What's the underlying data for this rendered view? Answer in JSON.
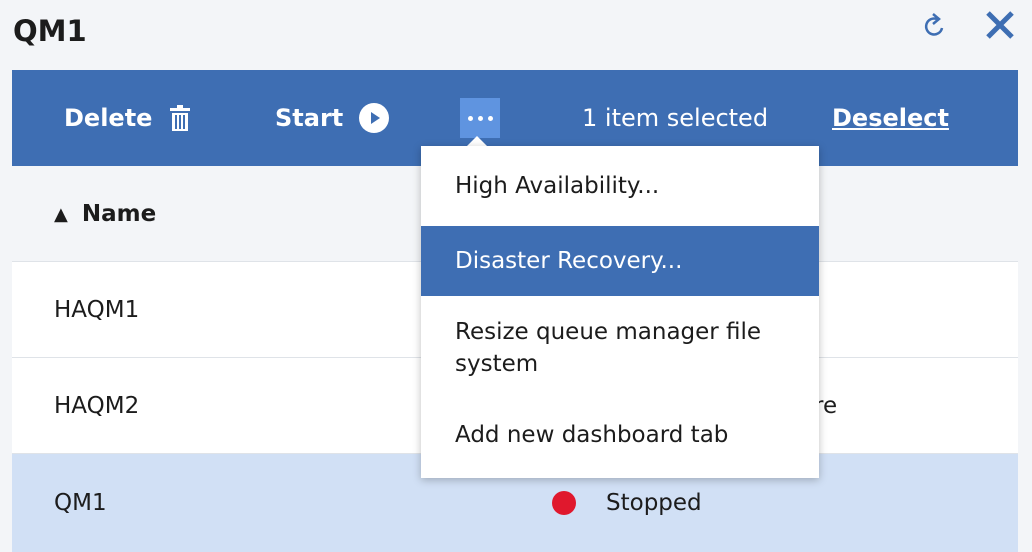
{
  "header": {
    "title": "QM1"
  },
  "toolbar": {
    "delete_label": "Delete",
    "start_label": "Start",
    "selected_text": "1 item selected",
    "deselect_label": "Deselect",
    "bg_color": "#3e6eb3"
  },
  "table": {
    "columns": [
      {
        "label": "Name",
        "sort": "ascending"
      }
    ],
    "rows": [
      {
        "name": "HAQM1",
        "status": ""
      },
      {
        "name": "HAQM2",
        "status": "re"
      },
      {
        "name": "QM1",
        "status": "Stopped",
        "selected": true
      }
    ]
  },
  "menu": {
    "items": [
      {
        "label": "High Availability...",
        "active": false
      },
      {
        "label": "Disaster Recovery...",
        "active": true
      },
      {
        "label": "Resize queue manager file system",
        "active": false
      },
      {
        "label": "Add new dashboard tab",
        "active": false
      }
    ]
  },
  "colors": {
    "accent": "#3e6eb3",
    "selected_row": "#d1e0f5",
    "stopped_status": "#e0182d"
  }
}
